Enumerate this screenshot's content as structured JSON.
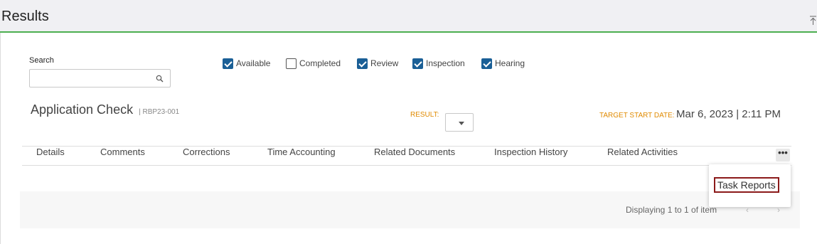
{
  "header": {
    "title": "Results"
  },
  "search": {
    "label": "Search",
    "value": ""
  },
  "filters": [
    {
      "label": "Available",
      "checked": true
    },
    {
      "label": "Completed",
      "checked": false
    },
    {
      "label": "Review",
      "checked": true
    },
    {
      "label": "Inspection",
      "checked": true
    },
    {
      "label": "Hearing",
      "checked": true
    }
  ],
  "record": {
    "title": "Application Check",
    "ref": "| RBP23-001",
    "result_label": "RESULT:",
    "result_value": "",
    "target_start_label": "TARGET START DATE:",
    "target_start_value": "Mar 6, 2023 | 2:11 PM"
  },
  "tabs": [
    "Details",
    "Comments",
    "Corrections",
    "Time Accounting",
    "Related Documents",
    "Inspection History",
    "Related Activities"
  ],
  "more_button": "•••",
  "menu": {
    "items": [
      "Task Reports"
    ]
  },
  "pager": {
    "text": "Displaying 1 to 1 of item",
    "prev": "‹",
    "next": "›"
  },
  "colors": {
    "accent_green": "#4caf50",
    "checkbox_blue": "#1a5f96",
    "label_orange": "#e08a00",
    "highlight_red": "#8b1a1a"
  }
}
